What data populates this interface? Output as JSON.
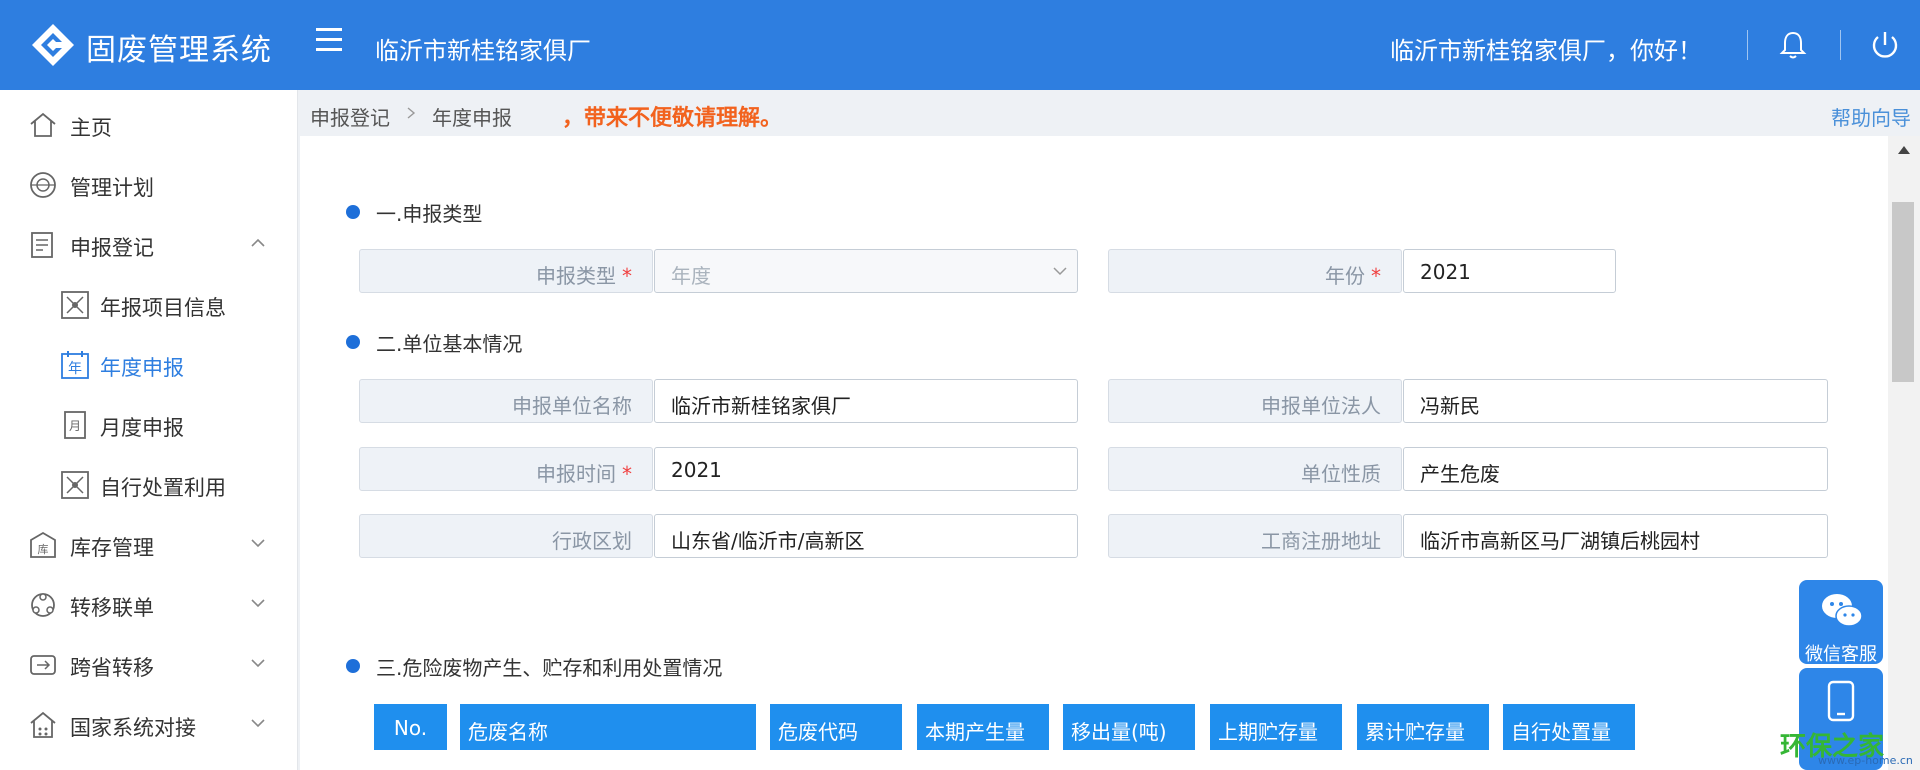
{
  "header": {
    "app_title": "固废管理系统",
    "company": "临沂市新桂铭家俱厂",
    "greeting": "临沂市新桂铭家俱厂，你好！",
    "icons": [
      "logo-icon",
      "menu-icon",
      "bell-icon",
      "power-icon"
    ]
  },
  "sidebar": {
    "items": [
      {
        "label": "主页",
        "icon": "home-icon"
      },
      {
        "label": "管理计划",
        "icon": "plan-icon"
      },
      {
        "label": "申报登记",
        "icon": "report-icon",
        "expanded": true
      },
      {
        "label": "年报项目信息",
        "icon": "project-icon"
      },
      {
        "label": "年度申报",
        "icon": "year-icon",
        "active": true
      },
      {
        "label": "月度申报",
        "icon": "month-icon"
      },
      {
        "label": "自行处置利用",
        "icon": "dispose-icon"
      },
      {
        "label": "库存管理",
        "icon": "warehouse-icon"
      },
      {
        "label": "转移联单",
        "icon": "transfer-icon"
      },
      {
        "label": "跨省转移",
        "icon": "cross-province-icon"
      },
      {
        "label": "国家系统对接",
        "icon": "national-icon"
      }
    ]
  },
  "breadcrumb": {
    "level1": "申报登记",
    "level2": "年度申报",
    "notice": "，带来不便敬请理解。",
    "help": "帮助向导"
  },
  "form": {
    "section1": "一.申报类型",
    "declare_type_label": "申报类型",
    "declare_type_value": "年度",
    "year_label": "年份",
    "year_value": "2021",
    "section2": "二.单位基本情况",
    "unit_name_label": "申报单位名称",
    "unit_name_value": "临沂市新桂铭家俱厂",
    "legal_person_label": "申报单位法人",
    "legal_person_value": "冯新民",
    "declare_time_label": "申报时间",
    "declare_time_value": "2021",
    "unit_nature_label": "单位性质",
    "unit_nature_value": "产生危废",
    "region_label": "行政区划",
    "region_value": "山东省/临沂市/高新区",
    "address_label": "工商注册地址",
    "address_value": "临沂市高新区马厂湖镇后桃园村",
    "section3": "三.危险废物产生、贮存和利用处置情况",
    "required_mark": "*"
  },
  "table": {
    "headers": [
      "No.",
      "危废名称",
      "危废代码",
      "本期产生量",
      "移出量(吨)",
      "上期贮存量",
      "累计贮存量",
      "自行处置量"
    ]
  },
  "floating": {
    "wechat": "微信客服",
    "mobile_icon": "mobile-icon"
  },
  "watermark": {
    "text": "环保之家",
    "url": "www.ep-home.cn"
  },
  "colors": {
    "header_bg": "#2e7ee0",
    "table_header_bg": "#1f8fee",
    "notice": "#f2621e",
    "accent": "#2e7ee0"
  }
}
